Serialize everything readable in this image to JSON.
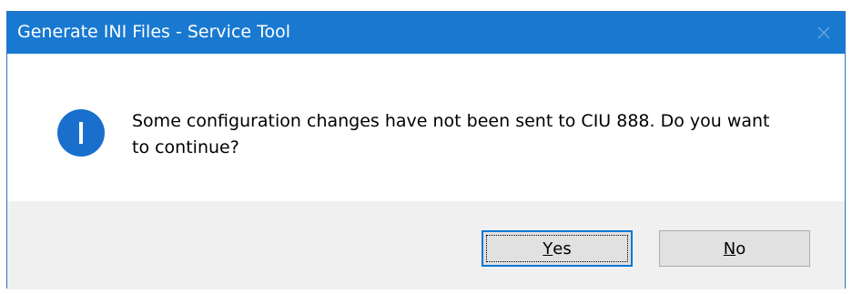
{
  "dialog": {
    "title": "Generate INI Files - Service Tool",
    "message": "Some configuration changes have not been sent to CIU 888. Do you want to continue?",
    "icon": "info-icon",
    "buttons": {
      "yes": {
        "mnemonic": "Y",
        "rest": "es"
      },
      "no": {
        "mnemonic": "N",
        "rest": "o"
      }
    },
    "colors": {
      "title_bar": "#1979d0",
      "info_icon": "#1a6fcd",
      "button_area": "#f0f0f0",
      "default_button_border": "#0078d7"
    }
  }
}
